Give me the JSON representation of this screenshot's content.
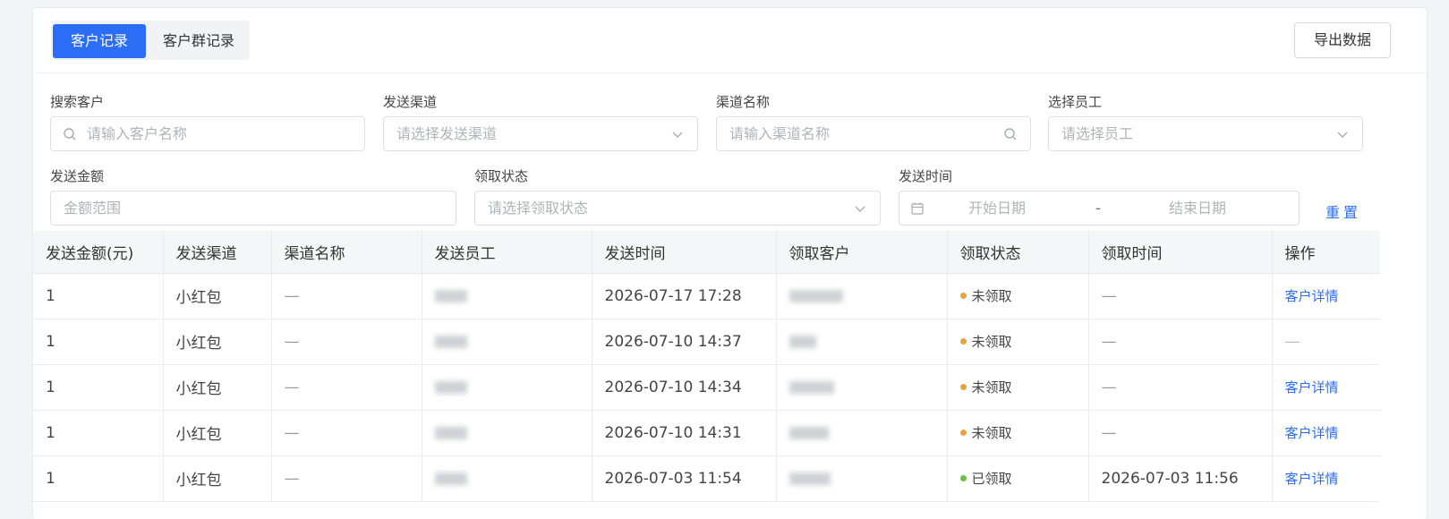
{
  "tabs": [
    {
      "label": "客户记录",
      "active": true
    },
    {
      "label": "客户群记录",
      "active": false
    }
  ],
  "export_label": "导出数据",
  "filters": {
    "search_customer": {
      "label": "搜索客户",
      "placeholder": "请输入客户名称",
      "icon": "search-icon"
    },
    "send_channel": {
      "label": "发送渠道",
      "placeholder": "请选择发送渠道",
      "icon": "chevron-down-icon"
    },
    "channel_name": {
      "label": "渠道名称",
      "placeholder": "请输入渠道名称",
      "icon": "search-icon"
    },
    "employee": {
      "label": "选择员工",
      "placeholder": "请选择员工",
      "icon": "chevron-down-icon"
    },
    "amount": {
      "label": "发送金额",
      "placeholder": "金额范围"
    },
    "claim_status": {
      "label": "领取状态",
      "placeholder": "请选择领取状态",
      "icon": "chevron-down-icon"
    },
    "send_time": {
      "label": "发送时间",
      "start_placeholder": "开始日期",
      "separator": "-",
      "end_placeholder": "结束日期",
      "icon": "calendar-icon"
    },
    "reset_label": "重置"
  },
  "table": {
    "columns": [
      "发送金额(元)",
      "发送渠道",
      "渠道名称",
      "发送员工",
      "发送时间",
      "领取客户",
      "领取状态",
      "领取时间",
      "操作"
    ],
    "rows": [
      {
        "amount": "1",
        "channel": "小红包",
        "channel_name": "—",
        "send_time": "2026-07-17 17:28",
        "status": "未领取",
        "status_color": "#e6a23c",
        "claim_time": "—",
        "action": "客户详情"
      },
      {
        "amount": "1",
        "channel": "小红包",
        "channel_name": "—",
        "send_time": "2026-07-10 14:37",
        "status": "未领取",
        "status_color": "#e6a23c",
        "claim_time": "—",
        "action": "—"
      },
      {
        "amount": "1",
        "channel": "小红包",
        "channel_name": "—",
        "send_time": "2026-07-10 14:34",
        "status": "未领取",
        "status_color": "#e6a23c",
        "claim_time": "—",
        "action": "客户详情"
      },
      {
        "amount": "1",
        "channel": "小红包",
        "channel_name": "—",
        "send_time": "2026-07-10 14:31",
        "status": "未领取",
        "status_color": "#e6a23c",
        "claim_time": "—",
        "action": "客户详情"
      },
      {
        "amount": "1",
        "channel": "小红包",
        "channel_name": "—",
        "send_time": "2026-07-03 11:54",
        "status": "已领取",
        "status_color": "#67c23a",
        "claim_time": "2026-07-03 11:56",
        "action": "客户详情"
      }
    ]
  },
  "colors": {
    "primary": "#2b6ef5",
    "pending": "#e6a23c",
    "claimed": "#67c23a"
  }
}
